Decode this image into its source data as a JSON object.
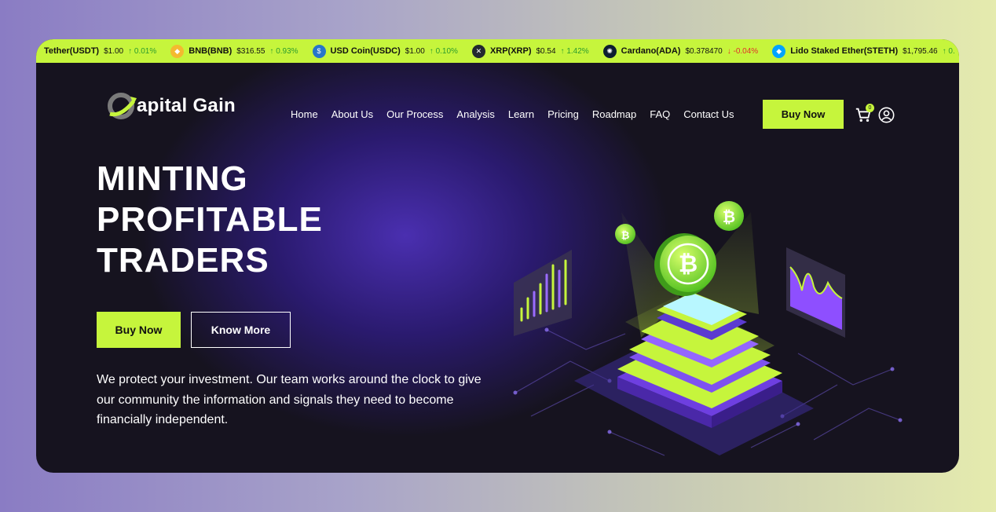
{
  "ticker": [
    {
      "name": "Tether(USDT)",
      "price": "$1.00",
      "change": "0.01%",
      "dir": "up",
      "arrow": "↑",
      "icon": "",
      "color": "#26a17b"
    },
    {
      "name": "BNB(BNB)",
      "price": "$316.55",
      "change": "0.93%",
      "dir": "up",
      "arrow": "↑",
      "icon": "◆",
      "color": "#f3ba2f"
    },
    {
      "name": "USD Coin(USDC)",
      "price": "$1.00",
      "change": "0.10%",
      "dir": "up",
      "arrow": "↑",
      "icon": "$",
      "color": "#2775ca"
    },
    {
      "name": "XRP(XRP)",
      "price": "$0.54",
      "change": "1.42%",
      "dir": "up",
      "arrow": "↑",
      "icon": "✕",
      "color": "#23292f"
    },
    {
      "name": "Cardano(ADA)",
      "price": "$0.378470",
      "change": "-0.04%",
      "dir": "down",
      "arrow": "↓",
      "icon": "✺",
      "color": "#0d1e30"
    },
    {
      "name": "Lido Staked Ether(STETH)",
      "price": "$1,795.46",
      "change": "0.",
      "dir": "up",
      "arrow": "↑",
      "icon": "◆",
      "color": "#00a3ff"
    }
  ],
  "brand": {
    "name": "apital Gain"
  },
  "nav": [
    "Home",
    "About Us",
    "Our Process",
    "Analysis",
    "Learn",
    "Pricing",
    "Roadmap",
    "FAQ",
    "Contact Us"
  ],
  "header": {
    "buy_label": "Buy Now",
    "cart_count": "0"
  },
  "hero": {
    "title_lines": [
      "MINTING",
      "PROFITABLE",
      "TRADERS"
    ],
    "buy_label": "Buy Now",
    "know_label": "Know More",
    "description": "We protect your investment. Our team works around the clock to give our community the information and signals they need to become financially independent."
  },
  "colors": {
    "accent": "#c6f53c",
    "dark": "#16131f",
    "purple": "#4a2fb0"
  },
  "icons": [
    "logo-icon",
    "cart-icon",
    "user-icon",
    "bitcoin-coin-icon"
  ]
}
